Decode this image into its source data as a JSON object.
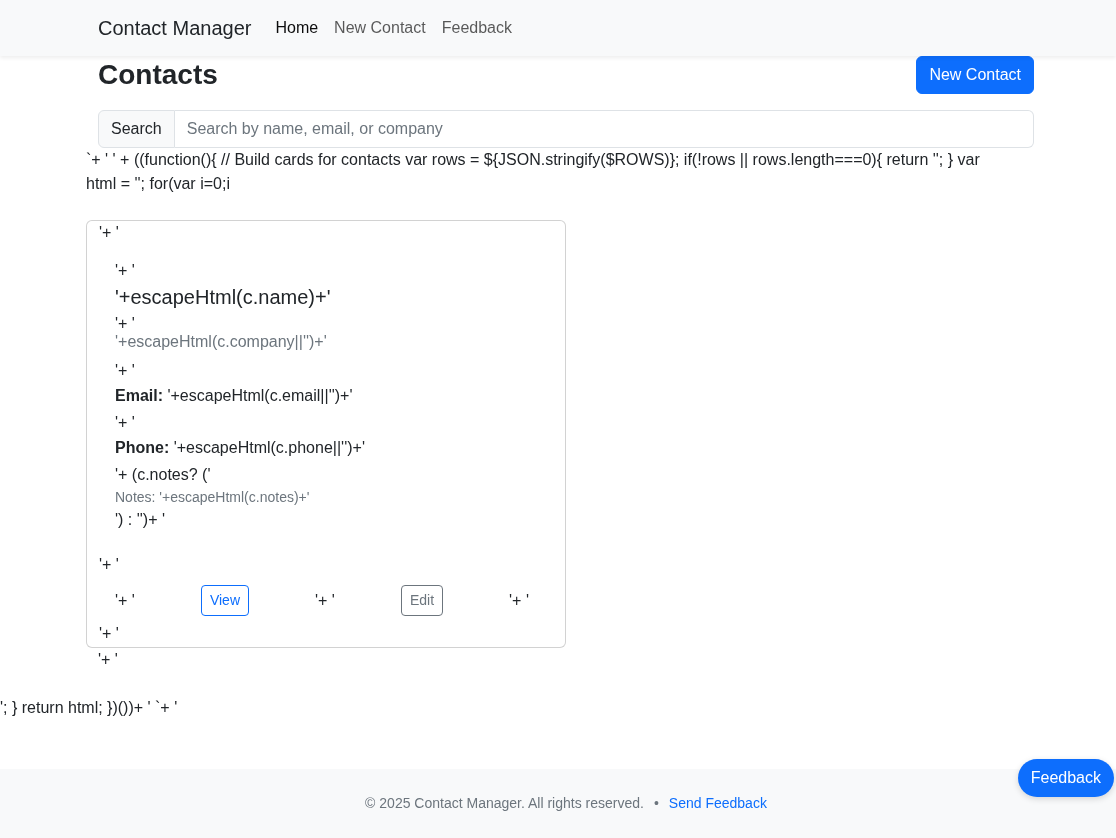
{
  "navbar": {
    "brand": "Contact Manager",
    "links": [
      {
        "label": "Home",
        "selected": true
      },
      {
        "label": "New Contact",
        "selected": false
      },
      {
        "label": "Feedback",
        "selected": false
      }
    ]
  },
  "header": {
    "title": "Contacts",
    "action": "New Contact"
  },
  "search": {
    "label": "Search",
    "placeholder": "Search by name, email, or company"
  },
  "template_text_top": "`+ ' ' + ((function(){ // Build cards for contacts var rows = ${JSON.stringify($ROWS)}; if(!rows || rows.length===0){ return ''; } var html = ''; for(var i=0;i",
  "contact_card": {
    "lead": "'+ '",
    "body": [
      {
        "kind": "plain",
        "text": "'+ '"
      },
      {
        "kind": "title",
        "text": "'+escapeHtml(c.name)+'"
      },
      {
        "kind": "plain",
        "text": "'+ '"
      },
      {
        "kind": "muted",
        "text": "'+escapeHtml(c.company||'')+'"
      },
      {
        "kind": "plain",
        "text": "'+ '"
      },
      {
        "kind": "field",
        "text": "**Email:** '+escapeHtml(c.email||'')+'"
      },
      {
        "kind": "plain",
        "text": "'+ '"
      },
      {
        "kind": "field",
        "text": "**Phone:** '+escapeHtml(c.phone||'')+'"
      },
      {
        "kind": "plain",
        "text": "'+ (c.notes? ('"
      },
      {
        "kind": "note",
        "text": "Notes: '+escapeHtml(c.notes)+'"
      },
      {
        "kind": "plain",
        "text": "') : '')+ '"
      }
    ],
    "separator": "'+ '",
    "actions": [
      {
        "kind": "text",
        "text": "'+ '"
      },
      {
        "kind": "button",
        "label": "View"
      },
      {
        "kind": "text",
        "text": "'+ '"
      },
      {
        "kind": "button",
        "label": "Edit"
      },
      {
        "kind": "text",
        "text": "'+ '"
      }
    ],
    "trail": "'+ '"
  },
  "template_text_after_card": "'+ '",
  "template_text_bottom": "'; } return html; })())+ ' `+ '",
  "footer": {
    "copyright": "© 2025 Contact Manager. All rights reserved.",
    "separator": "•",
    "link": "Send Feedback"
  },
  "feedback_button": "Feedback"
}
